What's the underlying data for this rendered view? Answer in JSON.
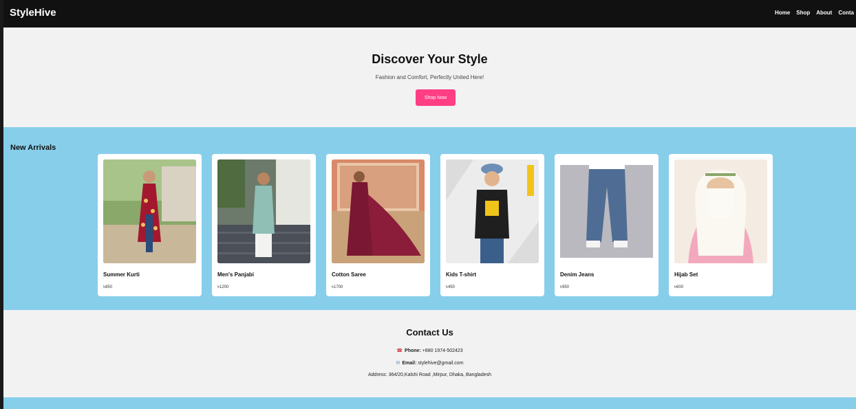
{
  "nav": {
    "brand": "StyleHive",
    "links": [
      "Home",
      "Shop",
      "About",
      "Conta"
    ]
  },
  "hero": {
    "title": "Discover Your Style",
    "subtitle": "Fashion and Comfort, Perfectly United Here!",
    "cta": "Shop Now"
  },
  "arrivals": {
    "title": "New Arrivals",
    "products": [
      {
        "name": "Summer Kurti",
        "price": "৳850"
      },
      {
        "name": "Men's Panjabi",
        "price": "৳1200"
      },
      {
        "name": "Cotton Saree",
        "price": "৳1700"
      },
      {
        "name": "Kids T-shirt",
        "price": "৳450"
      },
      {
        "name": "Denim Jeans",
        "price": "৳950"
      },
      {
        "name": "Hijab Set",
        "price": "৳600"
      }
    ]
  },
  "contact": {
    "title": "Contact Us",
    "phone_label": "Phone:",
    "phone": "+880 1974-502423",
    "email_label": "Email:",
    "email": "stylehive@gmail.com",
    "address": "Address: 364/20,Kalshi Road ,Mirpur, Dhaka, Bangladesh"
  },
  "colors": {
    "navbar": "#111111",
    "accent": "#ff3e84",
    "section_bg": "#87ceeb",
    "page_bg": "#f2f2f2"
  }
}
